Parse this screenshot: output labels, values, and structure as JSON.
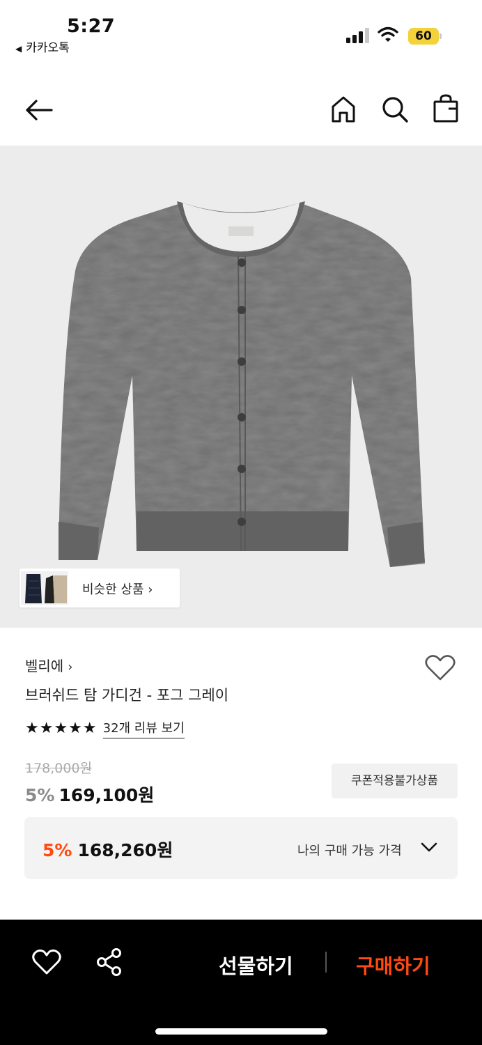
{
  "status_bar": {
    "time": "5:27",
    "back_app": "카카오톡",
    "battery": "60",
    "battery_color": "#f4d23c"
  },
  "nav": {
    "icons": [
      "back-arrow-icon",
      "home-icon",
      "search-icon",
      "shopping-bag-icon"
    ]
  },
  "product": {
    "similar_label": "비슷한 상품",
    "similar_chevron": "›",
    "brand": "벨리에",
    "brand_chevron": "›",
    "title": "브러쉬드 탐 가디건 - 포그 그레이",
    "stars": "★★★★★",
    "review_link": "32개 리뷰 보기",
    "original_price": "178,000원",
    "discount": "5%",
    "sale_price": "169,100원",
    "coupon_badge": "쿠폰적용불가상품",
    "my_price": {
      "discount": "5%",
      "price": "168,260원",
      "label": "나의 구매 가능 가격"
    }
  },
  "bottom_bar": {
    "gift": "선물하기",
    "buy": "구매하기",
    "accent_color": "#ff4a12"
  }
}
